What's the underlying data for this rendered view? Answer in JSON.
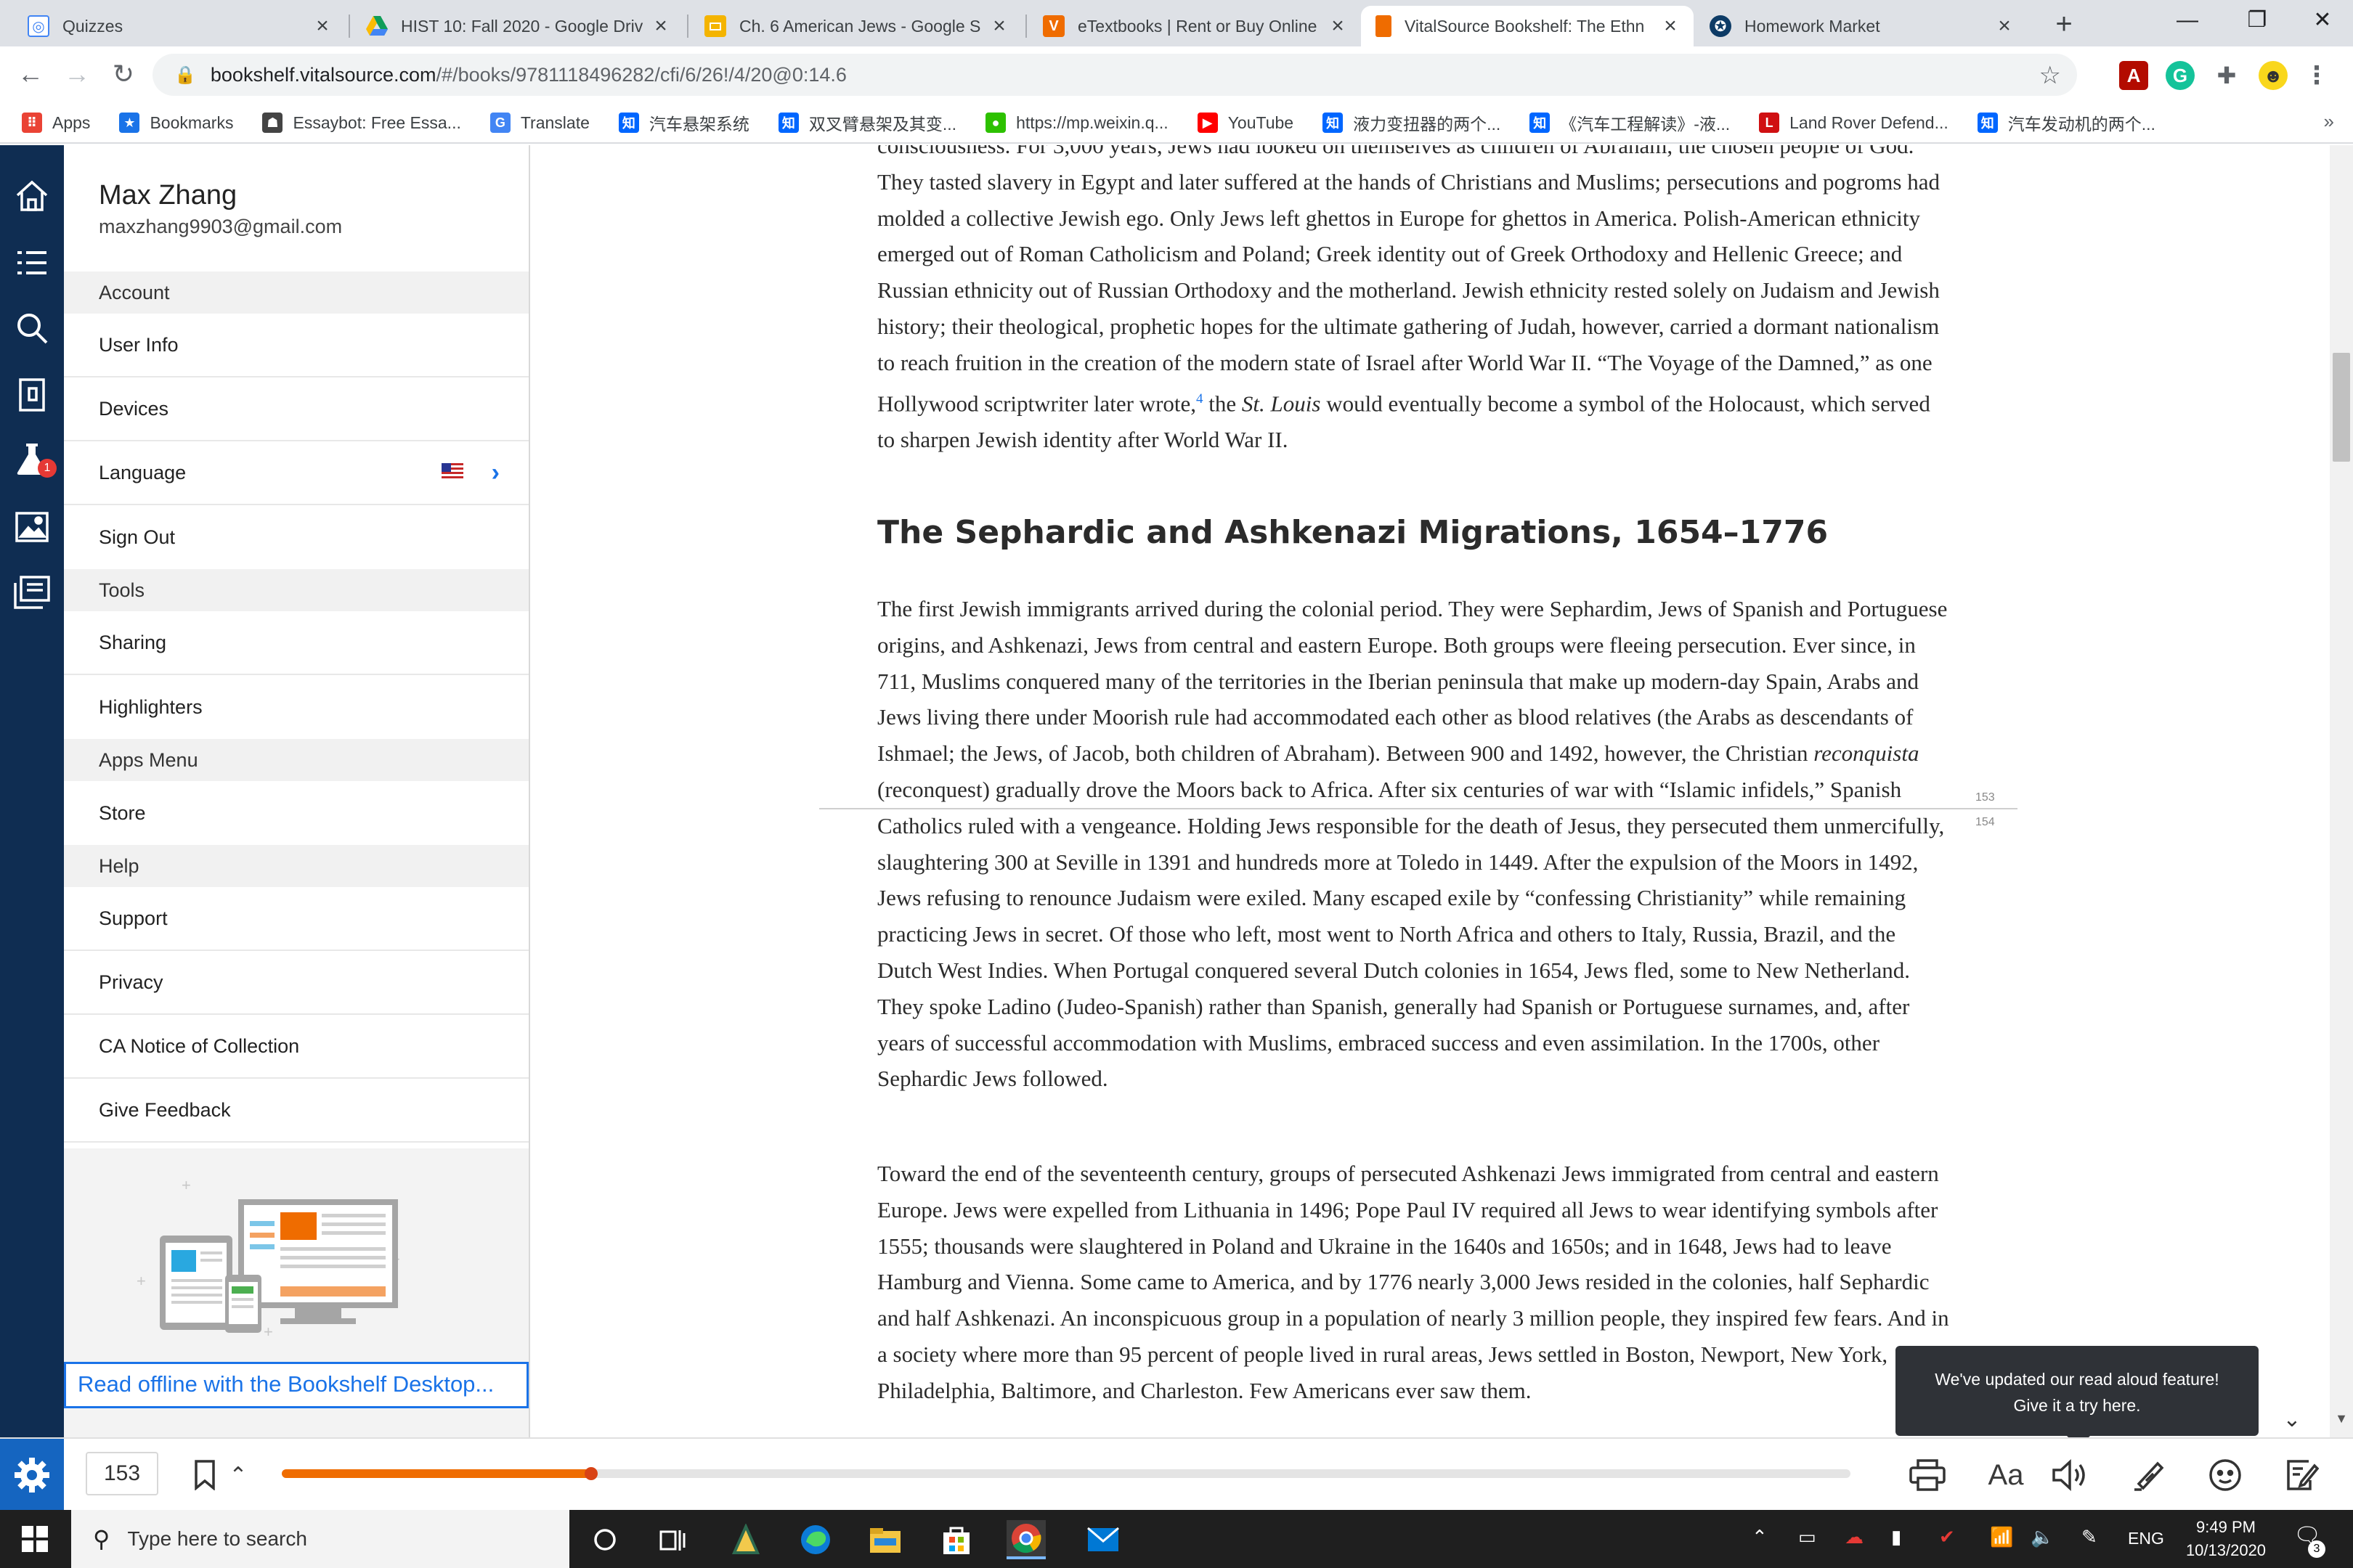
{
  "browser": {
    "tabs": [
      {
        "title": "Quizzes",
        "icon": "canvas-icon",
        "active": false
      },
      {
        "title": "HIST 10: Fall 2020 - Google Driv",
        "icon": "google-drive-icon",
        "active": false
      },
      {
        "title": "Ch. 6 American Jews - Google S",
        "icon": "google-slides-icon",
        "active": false
      },
      {
        "title": "eTextbooks | Rent or Buy Online",
        "icon": "vitalsource-v-icon",
        "active": false
      },
      {
        "title": "VitalSource Bookshelf: The Ethn",
        "icon": "bookshelf-icon",
        "active": true
      },
      {
        "title": "Homework Market",
        "icon": "homework-market-icon",
        "active": false
      }
    ],
    "url_host": "bookshelf.vitalsource.com",
    "url_path": "/#/books/9781118496282/cfi/6/26!/4/20@0:14.6",
    "bookmarks": [
      {
        "label": "Apps",
        "icon": "apps-grid-icon",
        "color": "#ea4335"
      },
      {
        "label": "Bookmarks",
        "icon": "star-icon",
        "color": "#1a73e8"
      },
      {
        "label": "Essaybot: Free Essa...",
        "icon": "essaybot-icon",
        "color": "#444444"
      },
      {
        "label": "Translate",
        "icon": "translate-icon",
        "color": "#4285f4"
      },
      {
        "label": "汽车悬架系统",
        "icon": "zhihu-icon",
        "color": "#0066ff"
      },
      {
        "label": "双叉臂悬架及其变...",
        "icon": "zhihu-icon",
        "color": "#0066ff"
      },
      {
        "label": "https://mp.weixin.q...",
        "icon": "wechat-icon",
        "color": "#2dc100"
      },
      {
        "label": "YouTube",
        "icon": "youtube-icon",
        "color": "#ff0000"
      },
      {
        "label": "液力变扭器的两个...",
        "icon": "zhihu-icon",
        "color": "#0066ff"
      },
      {
        "label": "《汽车工程解读》-液...",
        "icon": "zhihu-icon",
        "color": "#0066ff"
      },
      {
        "label": "Land Rover Defend...",
        "icon": "lego-icon",
        "color": "#d01012"
      },
      {
        "label": "汽车发动机的两个...",
        "icon": "zhihu-icon",
        "color": "#0066ff"
      }
    ]
  },
  "account": {
    "name": "Max Zhang",
    "email": "maxzhang9903@gmail.com",
    "sections": {
      "account": "Account",
      "tools": "Tools",
      "apps": "Apps Menu",
      "help": "Help"
    },
    "items": {
      "user_info": "User Info",
      "devices": "Devices",
      "language": "Language",
      "sign_out": "Sign Out",
      "sharing": "Sharing",
      "highlighters": "Highlighters",
      "store": "Store",
      "support": "Support",
      "privacy": "Privacy",
      "ca_notice": "CA Notice of Collection",
      "feedback": "Give Feedback"
    },
    "promo_link": "Read offline with the Bookshelf Desktop..."
  },
  "book": {
    "para1_a": "consciousness. For 3,000 years, Jews had looked on themselves as children of Abraham, the chosen people of God. They tasted slavery in Egypt and later suffered at the hands of Christians and Muslims; persecutions and pogroms had molded a collective Jewish ego. Only Jews left ghettos in Europe for ghettos in America. Polish-American ethnicity emerged out of Roman Catholicism and Poland; Greek identity out of Greek Orthodoxy and Hellenic Greece; and Russian ethnicity out of Russian Orthodoxy and the motherland. Jewish ethnicity rested solely on Judaism and Jewish history; their theological, prophetic hopes for the ultimate gathering of Judah, however, carried a dormant nationalism to reach fruition in the creation of the modern state of Israel after World War II. “The Voyage of the Damned,” as one Hollywood scriptwriter later wrote,",
    "footnote": "4",
    "para1_b": " the ",
    "para1_italic": "St. Louis",
    "para1_c": " would eventually become a symbol of the Holocaust, which served to sharpen Jewish identity after World War II.",
    "heading": "The Sephardic and Ashkenazi Migrations, 1654–1776",
    "para2_a": "The first Jewish immigrants arrived during the colonial period. They were Sephardim, Jews of Spanish and Portuguese origins, and Ashkenazi, Jews from central and eastern Europe. Both groups were fleeing persecution. Ever since, in 711, Muslims conquered many of the territories in the Iberian peninsula that make up modern-day Spain, Arabs and Jews living there under Moorish rule had accommodated each other as blood relatives (the Arabs as descendants of Ishmael; the Jews, of Jacob, both children of Abraham). Between 900 and 1492, however, the Christian ",
    "para2_italic": "reconquista",
    "para2_b": " (reconquest) gradually drove the Moors back to Africa. After six centuries of war with “Islamic infidels,” Spanish Catholics ruled with a vengeance. Holding Jews responsible for the death of Jesus, they persecuted them unmercifully, slaughtering 300 at Seville in 1391 and hundreds more at Toledo in 1449. After the expulsion of the Moors in 1492, Jews refusing to renounce Judaism were exiled. Many escaped exile by “confessing Christianity” while remaining practicing Jews in secret. Of those who left, most went to North Africa and others to Italy, Russia, Brazil, and the Dutch West Indies. When Portugal conquered several Dutch colonies in 1654, Jews fled, some to New Netherland. They spoke Ladino (Judeo-Spanish) rather than Spanish, generally had Spanish or Portuguese surnames, and, after years of successful accommodation with Muslims, embraced success and even assimilation. In the 1700s, other Sephardic Jews followed.",
    "para3": "Toward the end of the seventeenth century, groups of persecuted Ashkenazi Jews immigrated from central and eastern Europe. Jews were expelled from Lithuania in 1496; Pope Paul IV required all Jews to wear identifying symbols after 1555; thousands were slaughtered in Poland and Ukraine in the 1640s and 1650s; and in 1648, Jews had to leave Hamburg and Vienna. Some came to America, and by 1776 nearly 3,000 Jews resided in the colonies, half Sephardic and half Ashkenazi. An inconspicuous group in a population of nearly 3 million people, they inspired few fears. And in a society where more than 95 percent of people lived in rural areas, Jews settled in Boston, Newport, New York, Philadelphia, Baltimore, and Charleston. Few Americans ever saw them.",
    "page_marker_prev": "153",
    "page_marker_next": "154"
  },
  "reader_bar": {
    "page": "153",
    "progress_fraction": 0.197
  },
  "toast": {
    "line1": "We've updated our read aloud feature!",
    "line2": "Give it a try here."
  },
  "taskbar": {
    "search_placeholder": "Type here to search",
    "lang": "ENG",
    "time": "9:49 PM",
    "date": "10/13/2020",
    "notif_count": "3"
  },
  "colors": {
    "rail": "#0f2d52",
    "accent": "#1a73e8",
    "progress": "#ef6c00"
  }
}
